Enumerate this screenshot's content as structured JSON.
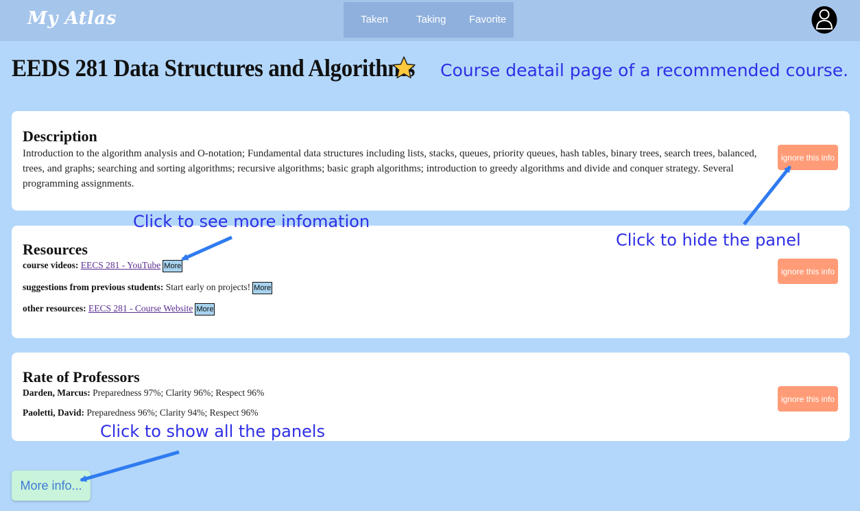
{
  "app": {
    "brand": "My Atlas"
  },
  "nav": {
    "tabs": [
      {
        "label": "Taken"
      },
      {
        "label": "Taking"
      },
      {
        "label": "Favorite"
      }
    ]
  },
  "icons": {
    "avatar": "user-avatar-icon",
    "favorite": "star-icon"
  },
  "course": {
    "title": "EEDS 281 Data Structures and Algorithms"
  },
  "annotations": {
    "page": "Course deatail page of a recommended course.",
    "see_more": "Click to see more infomation",
    "hide_panel": "Click to hide the panel",
    "show_all": "Click to show all the panels"
  },
  "description": {
    "heading": "Description",
    "text": "Introduction to the algorithm analysis and O-notation; Fundamental data structures including lists, stacks, queues, priority queues, hash tables, binary trees, search trees, balanced, trees, and graphs; searching and sorting algorithms; recursive algorithms; basic graph algorithms; introduction to greedy algorithms and divide and conquer strategy. Several programming assignments."
  },
  "resources": {
    "heading": "Resources",
    "rows": [
      {
        "label": "course videos:",
        "link": "EECS 281 - YouTube",
        "more": "More"
      },
      {
        "label": "suggestions from previous students:",
        "text": "Start early on projects!",
        "more": "More"
      },
      {
        "label": "other resources:",
        "link": "EECS 281 - Course Website",
        "more": "More"
      }
    ]
  },
  "professors": {
    "heading": "Rate of Professors",
    "rows": [
      {
        "name": "Darden, Marcus:",
        "ratings": "Preparedness 97%; Clarity 96%; Respect 96%"
      },
      {
        "name": "Paoletti, David:",
        "ratings": "Preparedness 96%; Clarity 94%; Respect 96%"
      }
    ]
  },
  "buttons": {
    "ignore": "ignore this info",
    "more_info": "More info..."
  },
  "colors": {
    "background": "#b3d7fb",
    "navbar": "#a5c5eb",
    "ignore_button": "#ff9c77",
    "annotation": "#2f2fe6",
    "arrow": "#2f7bf0"
  }
}
